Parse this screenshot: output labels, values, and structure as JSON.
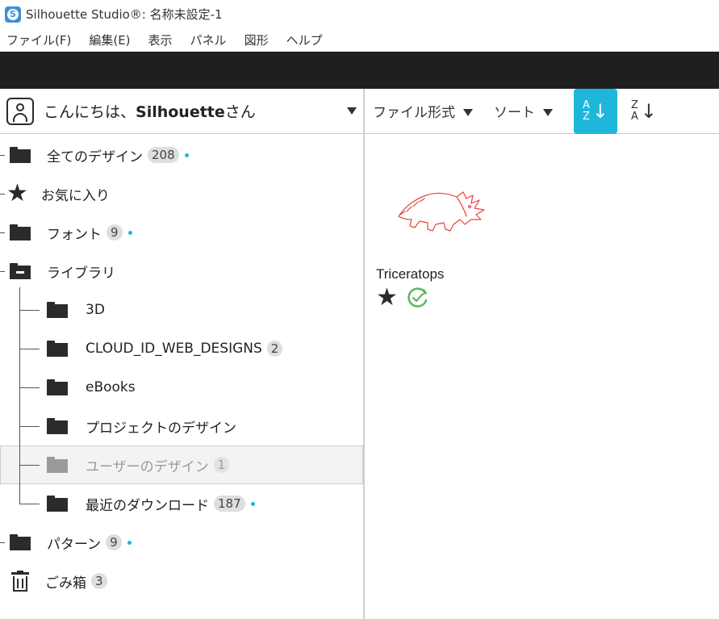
{
  "window": {
    "title": "Silhouette Studio®: 名称未設定-1",
    "app_icon_letter": "S"
  },
  "menu": [
    "ファイル(F)",
    "編集(E)",
    "表示",
    "パネル",
    "図形",
    "ヘルプ"
  ],
  "library_header": {
    "greeting_prefix": "こんにちは、",
    "user_name": "Silhouette",
    "greeting_suffix": "さん"
  },
  "toolbar": {
    "file_type_label": "ファイル形式",
    "sort_label": "ソート",
    "sort_az_top": "A",
    "sort_az_bottom": "Z",
    "sort_za_top": "Z",
    "sort_za_bottom": "A",
    "sort_arrow": "↓"
  },
  "tree": {
    "all_designs": {
      "label": "全てのデザイン",
      "count": "208"
    },
    "favorites": {
      "label": "お気に入り"
    },
    "fonts": {
      "label": "フォント",
      "count": "9"
    },
    "library": {
      "label": "ライブラリ"
    },
    "lib_3d": {
      "label": "3D"
    },
    "lib_cloud": {
      "label": "CLOUD_ID_WEB_DESIGNS",
      "count": "2"
    },
    "lib_ebooks": {
      "label": "eBooks"
    },
    "lib_project": {
      "label": "プロジェクトのデザイン"
    },
    "lib_user": {
      "label": "ユーザーのデザイン",
      "count": "1"
    },
    "lib_recent": {
      "label": "最近のダウンロード",
      "count": "187"
    },
    "patterns": {
      "label": "パターン",
      "count": "9"
    },
    "trash": {
      "label": "ごみ箱",
      "count": "3"
    }
  },
  "design": {
    "name": "Triceratops"
  },
  "colors": {
    "accent": "#1fb6dc",
    "dark_bar": "#1d1f20",
    "design_stroke": "#e8423c",
    "synced": "#5cb85c"
  }
}
